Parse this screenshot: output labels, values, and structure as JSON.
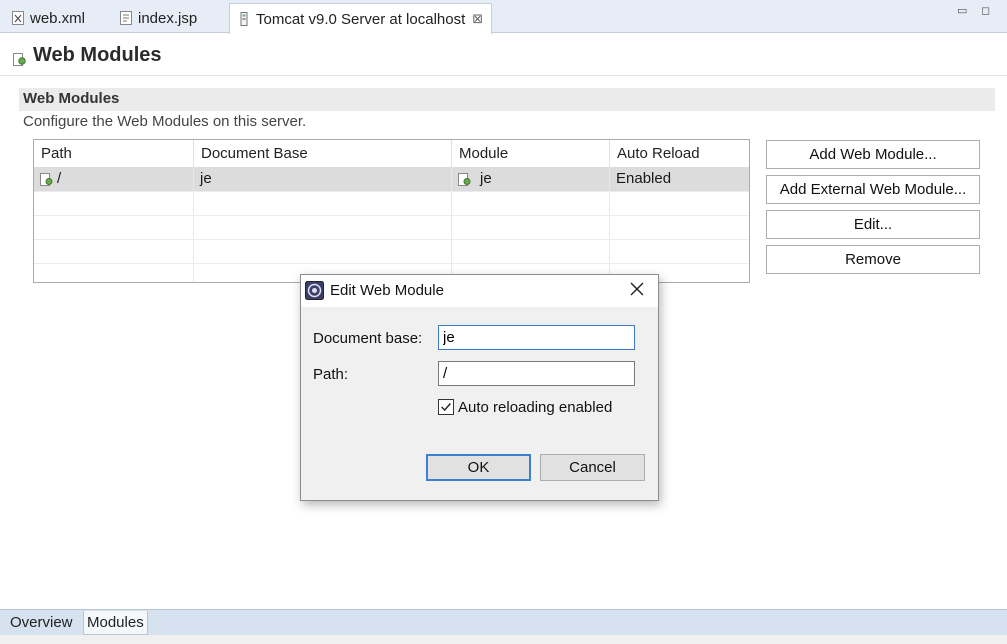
{
  "editor_tabs": [
    {
      "label": "web.xml",
      "icon": "xml-file-icon"
    },
    {
      "label": "index.jsp",
      "icon": "jsp-file-icon"
    },
    {
      "label": "Tomcat v9.0 Server at localhost",
      "icon": "server-icon",
      "active": true
    }
  ],
  "close_glyph": "⊠",
  "window_controls": {
    "minimize": "▭",
    "maximize": "◻"
  },
  "page": {
    "title": "Web Modules"
  },
  "section": {
    "title": "Web Modules",
    "description": "Configure the Web Modules on this server."
  },
  "table": {
    "columns": [
      "Path",
      "Document Base",
      "Module",
      "Auto Reload"
    ],
    "rows": [
      {
        "path": "/",
        "document_base": "je",
        "module": "je",
        "auto_reload": "Enabled"
      }
    ]
  },
  "buttons": {
    "add_web_module": "Add Web Module...",
    "add_external": "Add External Web Module...",
    "edit": "Edit...",
    "remove": "Remove"
  },
  "dialog": {
    "title": "Edit Web Module",
    "document_base_label": "Document base:",
    "document_base_value": "je",
    "path_label": "Path:",
    "path_value": "/",
    "auto_reload_label": "Auto reloading enabled",
    "auto_reload_checked": true,
    "ok_label": "OK",
    "cancel_label": "Cancel"
  },
  "bottom_tabs": [
    {
      "label": "Overview"
    },
    {
      "label": "Modules",
      "active": true
    }
  ],
  "colors": {
    "tabbar_bg": "#e6edf6",
    "selection_row": "#dcdcdc",
    "default_button_border": "#3c80d0",
    "bottom_bar_bg": "#d6e2f0"
  }
}
